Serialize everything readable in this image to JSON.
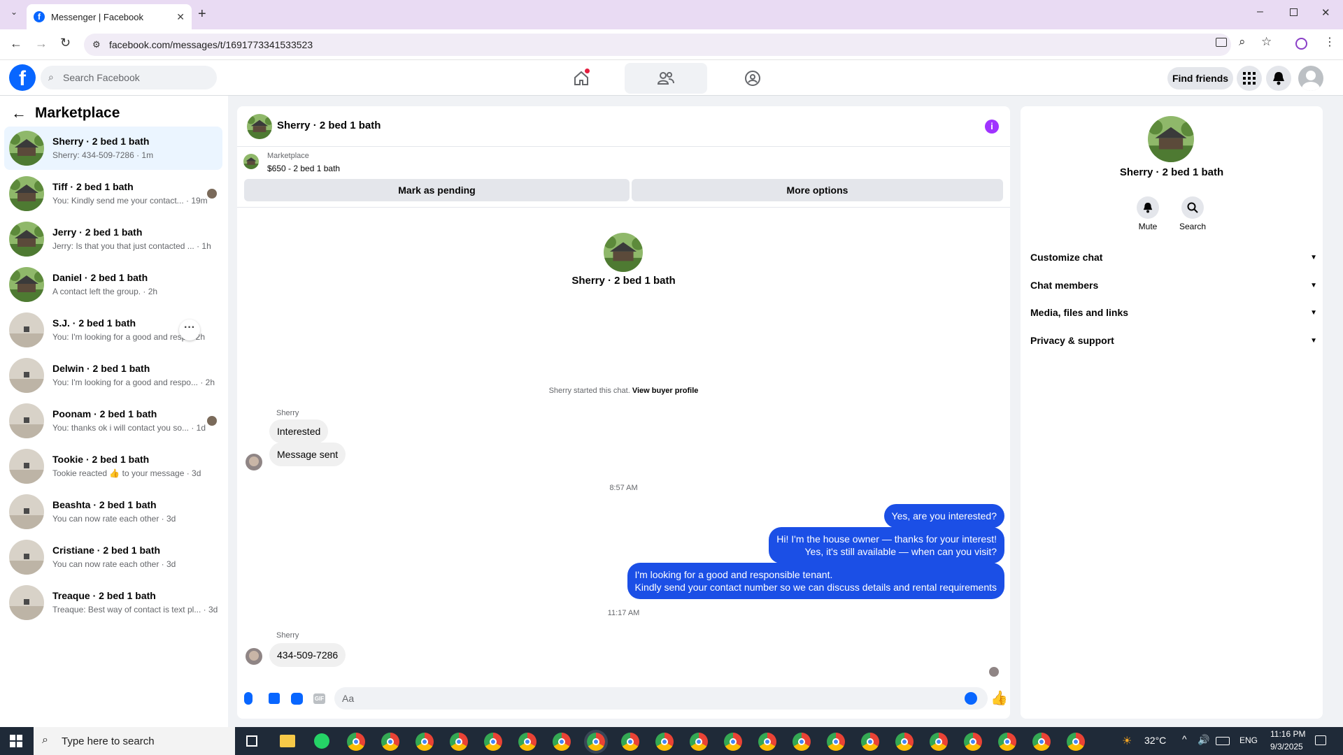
{
  "browser": {
    "tab_title": "Messenger | Facebook",
    "url": "facebook.com/messages/t/1691773341533523"
  },
  "fb": {
    "search_placeholder": "Search Facebook",
    "find_friends": "Find friends"
  },
  "sidebar": {
    "title": "Marketplace",
    "conversations": [
      {
        "name": "Sherry · 2 bed 1 bath",
        "preview": "Sherry: 434-509-7286 · 1m"
      },
      {
        "name": "Tiff · 2 bed 1 bath",
        "preview": "You: Kindly send me your contact... · 19m"
      },
      {
        "name": "Jerry · 2 bed 1 bath",
        "preview": "Jerry: Is that you that just contacted ... · 1h"
      },
      {
        "name": "Daniel · 2 bed 1 bath",
        "preview": "A contact left the group. · 2h"
      },
      {
        "name": "S.J. · 2 bed 1 bath",
        "preview": "You: I'm looking for a good and resp... 2h"
      },
      {
        "name": "Delwin · 2 bed 1 bath",
        "preview": "You: I'm looking for a good and respo... · 2h"
      },
      {
        "name": "Poonam · 2 bed 1 bath",
        "preview": "You: thanks ok i will contact you so... · 1d"
      },
      {
        "name": "Tookie · 2 bed 1 bath",
        "preview": "Tookie reacted 👍 to your message · 3d"
      },
      {
        "name": "Beashta · 2 bed 1 bath",
        "preview": "You can now rate each other · 3d"
      },
      {
        "name": "Cristiane · 2 bed 1 bath",
        "preview": "You can now rate each other · 3d"
      },
      {
        "name": "Treaque · 2 bed 1 bath",
        "preview": "Treaque: Best way of contact is text pl... · 3d"
      }
    ]
  },
  "chat": {
    "title": "Sherry · 2 bed 1 bath",
    "listing_source": "Marketplace",
    "listing": "$650 - 2 bed 1 bath",
    "mark_pending": "Mark as pending",
    "more_options": "More options",
    "intro_name": "Sherry · 2 bed 1 bath",
    "started_text": "Sherry started this chat.",
    "view_profile": "View buyer profile",
    "sender": "Sherry",
    "msg_interested": "Interested",
    "msg_sent": "Message sent",
    "time1": "8:57 AM",
    "out1": "Yes, are you interested?",
    "out2a": "Hi! I'm the house owner — thanks for your interest!",
    "out2b": "Yes, it's still available — when can you visit?",
    "out3a": "I'm looking for a good and responsible tenant.",
    "out3b": "Kindly send your contact number so we can discuss details and rental requirements",
    "time2": "11:17 AM",
    "sender2": "Sherry",
    "msg_phone": "434-509-7286",
    "composer_placeholder": "Aa"
  },
  "details": {
    "name": "Sherry · 2 bed 1 bath",
    "mute": "Mute",
    "search": "Search",
    "options": [
      "Customize chat",
      "Chat members",
      "Media, files and links",
      "Privacy & support"
    ]
  },
  "taskbar": {
    "search_placeholder": "Type here to search",
    "temperature": "32°C",
    "lang": "ENG",
    "time": "11:16 PM",
    "date": "9/3/2025"
  },
  "colors": {
    "fb_blue": "#0866ff",
    "bubble_out": "#1b4fe6",
    "active_row": "#ebf5ff",
    "info_purple": "#a033ff"
  }
}
